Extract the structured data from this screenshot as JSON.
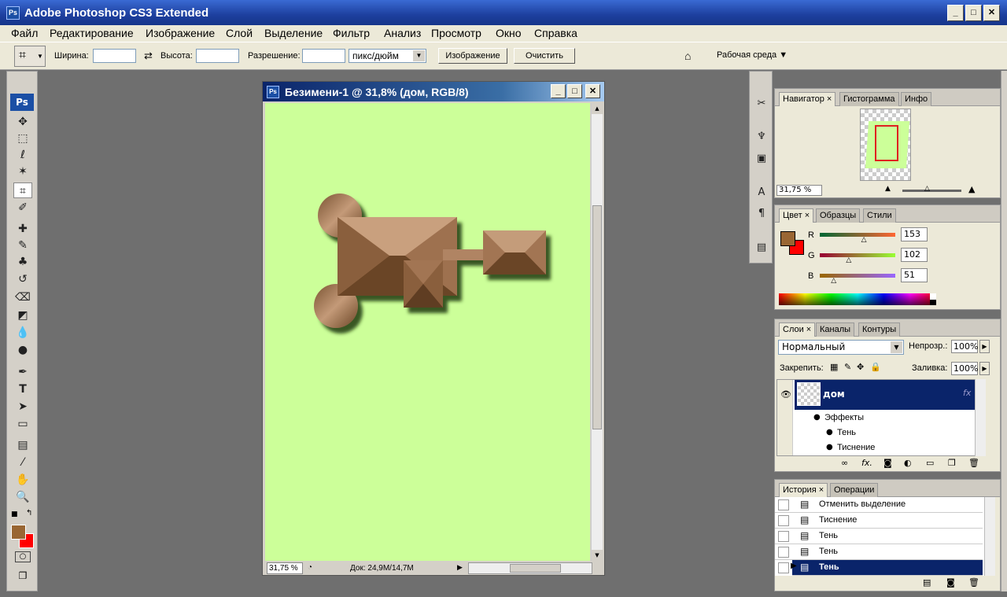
{
  "app": {
    "title": "Adobe Photoshop CS3 Extended",
    "icon_label": "Ps"
  },
  "window_controls": {
    "minimize": "_",
    "maximize": "□",
    "close": "✕"
  },
  "menu": [
    "Файл",
    "Редактирование",
    "Изображение",
    "Слой",
    "Выделение",
    "Фильтр",
    "Анализ",
    "Просмотр",
    "Окно",
    "Справка"
  ],
  "options": {
    "width_label": "Ширина:",
    "width_value": "",
    "height_label": "Высота:",
    "height_value": "",
    "resolution_label": "Разрешение:",
    "resolution_value": "",
    "units": "пикс/дюйм",
    "image_button": "Изображение",
    "clear_button": "Очистить",
    "workspace": "Рабочая среда ▼"
  },
  "colors": {
    "fg": "#996633",
    "bg": "#ff0000",
    "canvas": "#ccff99",
    "selection": "#0a246a"
  },
  "document": {
    "title": "Безимени-1 @ 31,8% (дом, RGB/8)",
    "zoom": "31,75 %",
    "doc_info": "Док: 24,9M/14,7M"
  },
  "navigator": {
    "tabs": [
      "Навигатор",
      "Гистограмма",
      "Инфо"
    ],
    "zoom": "31,75 %"
  },
  "color_panel": {
    "tabs": [
      "Цвет",
      "Образцы",
      "Стили"
    ],
    "channels": [
      {
        "label": "R",
        "value": "153",
        "level": 0.6
      },
      {
        "label": "G",
        "value": "102",
        "level": 0.4
      },
      {
        "label": "B",
        "value": "51",
        "level": 0.2
      }
    ]
  },
  "layers": {
    "tabs": [
      "Слои",
      "Каналы",
      "Контуры"
    ],
    "blend_mode": "Нормальный",
    "opacity_label": "Непрозр.:",
    "opacity": "100%",
    "lock_label": "Закрепить:",
    "fill_label": "Заливка:",
    "fill": "100%",
    "layer_name": "дом",
    "effects_label": "Эффекты",
    "effects": [
      "Тень",
      "Тиснение"
    ]
  },
  "history": {
    "tabs": [
      "История",
      "Операции"
    ],
    "items": [
      "Отменить выделение",
      "Тиснение",
      "Тень",
      "Тень",
      "Тень"
    ]
  }
}
